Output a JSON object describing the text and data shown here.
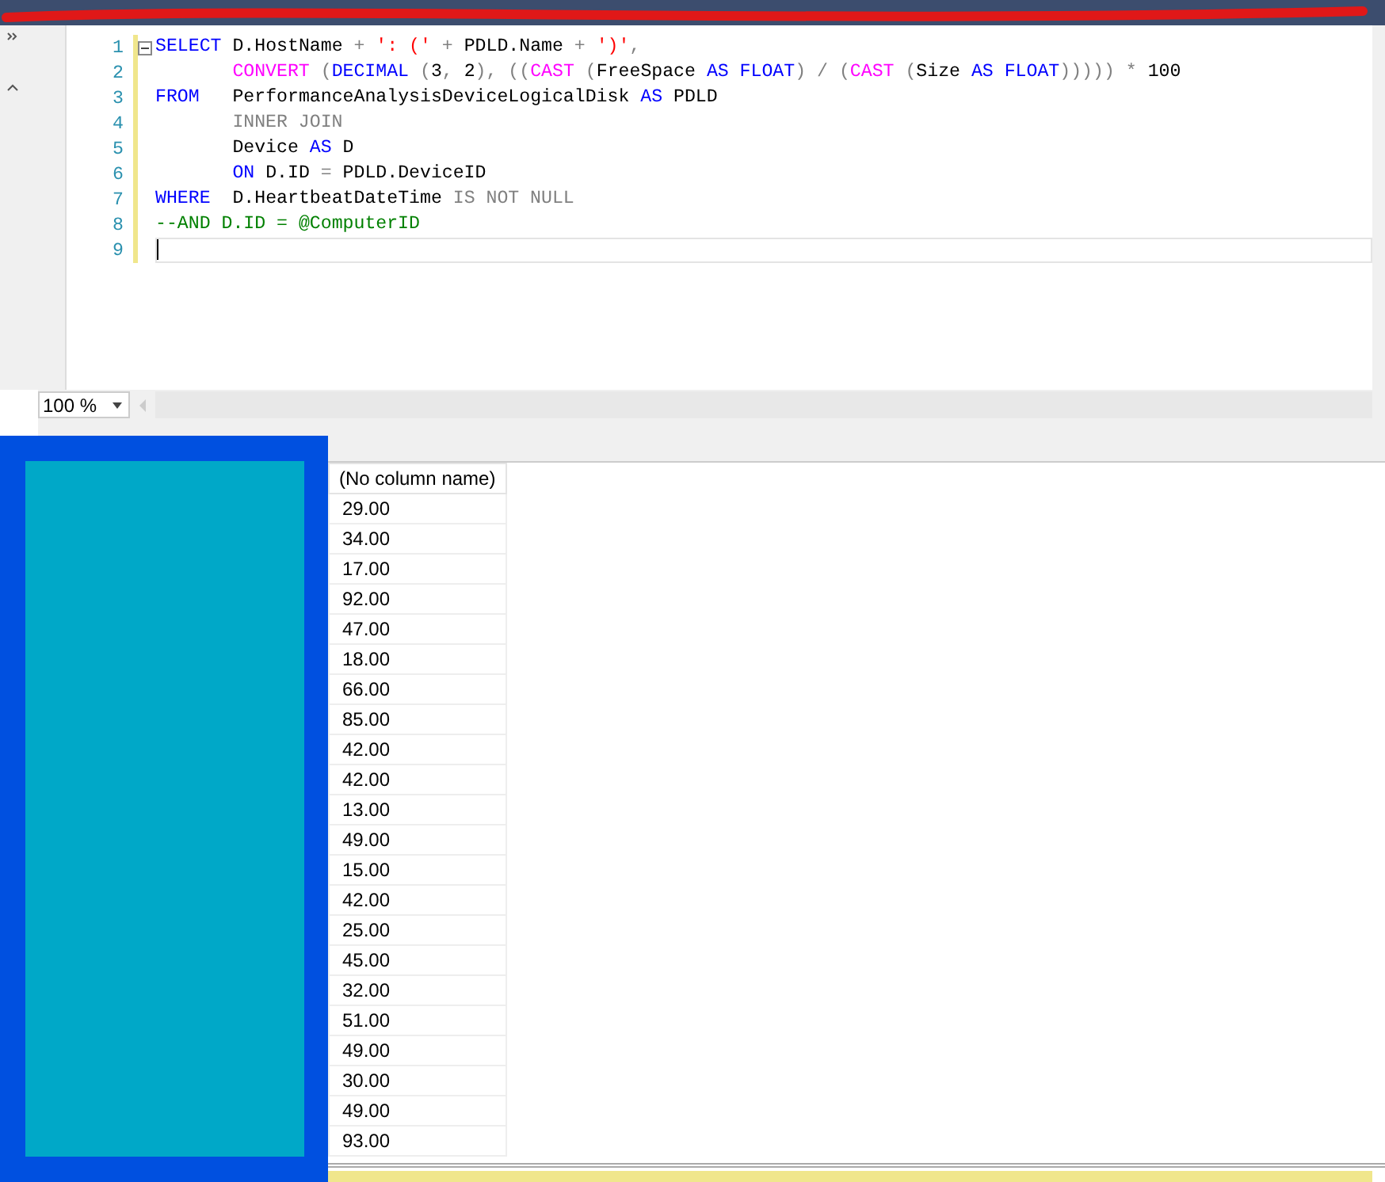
{
  "editor": {
    "lines": [
      {
        "number": "1",
        "collapsible": true,
        "indented": false,
        "current": false,
        "tokens": [
          {
            "kind": "keyword",
            "text": "SELECT"
          },
          {
            "kind": "plain",
            "text": " D.HostName "
          },
          {
            "kind": "operator",
            "text": "+ "
          },
          {
            "kind": "string",
            "text": "': ('"
          },
          {
            "kind": "operator",
            "text": " + "
          },
          {
            "kind": "plain",
            "text": "PDLD.Name "
          },
          {
            "kind": "operator",
            "text": "+ "
          },
          {
            "kind": "string",
            "text": "')'"
          },
          {
            "kind": "operator",
            "text": ","
          }
        ]
      },
      {
        "number": "2",
        "collapsible": false,
        "indented": true,
        "current": false,
        "tokens": [
          {
            "kind": "function",
            "text": "CONVERT"
          },
          {
            "kind": "operator",
            "text": " ("
          },
          {
            "kind": "keyword",
            "text": "DECIMAL"
          },
          {
            "kind": "operator",
            "text": " ("
          },
          {
            "kind": "plain",
            "text": "3"
          },
          {
            "kind": "operator",
            "text": ", "
          },
          {
            "kind": "plain",
            "text": "2"
          },
          {
            "kind": "operator",
            "text": "), (("
          },
          {
            "kind": "function",
            "text": "CAST"
          },
          {
            "kind": "operator",
            "text": " ("
          },
          {
            "kind": "plain",
            "text": "FreeSpace "
          },
          {
            "kind": "keyword",
            "text": "AS FLOAT"
          },
          {
            "kind": "operator",
            "text": ") / ("
          },
          {
            "kind": "function",
            "text": "CAST"
          },
          {
            "kind": "operator",
            "text": " ("
          },
          {
            "kind": "plain",
            "text": "Size "
          },
          {
            "kind": "keyword",
            "text": "AS FLOAT"
          },
          {
            "kind": "operator",
            "text": "))))) * "
          },
          {
            "kind": "plain",
            "text": "100"
          }
        ]
      },
      {
        "number": "3",
        "collapsible": false,
        "indented": false,
        "current": false,
        "tokens": [
          {
            "kind": "keyword",
            "text": "FROM"
          },
          {
            "kind": "plain",
            "text": "   PerformanceAnalysisDeviceLogicalDisk "
          },
          {
            "kind": "keyword",
            "text": "AS"
          },
          {
            "kind": "plain",
            "text": " PDLD"
          }
        ]
      },
      {
        "number": "4",
        "collapsible": false,
        "indented": true,
        "current": false,
        "tokens": [
          {
            "kind": "operator",
            "text": "INNER JOIN"
          }
        ]
      },
      {
        "number": "5",
        "collapsible": false,
        "indented": true,
        "current": false,
        "tokens": [
          {
            "kind": "plain",
            "text": "Device "
          },
          {
            "kind": "keyword",
            "text": "AS"
          },
          {
            "kind": "plain",
            "text": " D"
          }
        ]
      },
      {
        "number": "6",
        "collapsible": false,
        "indented": true,
        "current": false,
        "tokens": [
          {
            "kind": "keyword",
            "text": "ON"
          },
          {
            "kind": "plain",
            "text": " D.ID "
          },
          {
            "kind": "operator",
            "text": "= "
          },
          {
            "kind": "plain",
            "text": "PDLD.DeviceID"
          }
        ]
      },
      {
        "number": "7",
        "collapsible": false,
        "indented": false,
        "current": false,
        "tokens": [
          {
            "kind": "keyword",
            "text": "WHERE"
          },
          {
            "kind": "plain",
            "text": "  D.HeartbeatDateTime "
          },
          {
            "kind": "operator",
            "text": "IS NOT NULL"
          }
        ]
      },
      {
        "number": "8",
        "collapsible": false,
        "indented": false,
        "current": false,
        "tokens": [
          {
            "kind": "comment",
            "text": "--AND D.ID = @ComputerID"
          }
        ]
      },
      {
        "number": "9",
        "collapsible": false,
        "indented": false,
        "current": true
      }
    ]
  },
  "zoom": {
    "value": "100 %"
  },
  "results": {
    "columns": [
      "(No column name)"
    ],
    "rows": [
      [
        "29.00"
      ],
      [
        "34.00"
      ],
      [
        "17.00"
      ],
      [
        "92.00"
      ],
      [
        "47.00"
      ],
      [
        "18.00"
      ],
      [
        "66.00"
      ],
      [
        "85.00"
      ],
      [
        "42.00"
      ],
      [
        "42.00"
      ],
      [
        "13.00"
      ],
      [
        "49.00"
      ],
      [
        "15.00"
      ],
      [
        "42.00"
      ],
      [
        "25.00"
      ],
      [
        "45.00"
      ],
      [
        "32.00"
      ],
      [
        "51.00"
      ],
      [
        "49.00"
      ],
      [
        "30.00"
      ],
      [
        "49.00"
      ],
      [
        "93.00"
      ]
    ]
  }
}
